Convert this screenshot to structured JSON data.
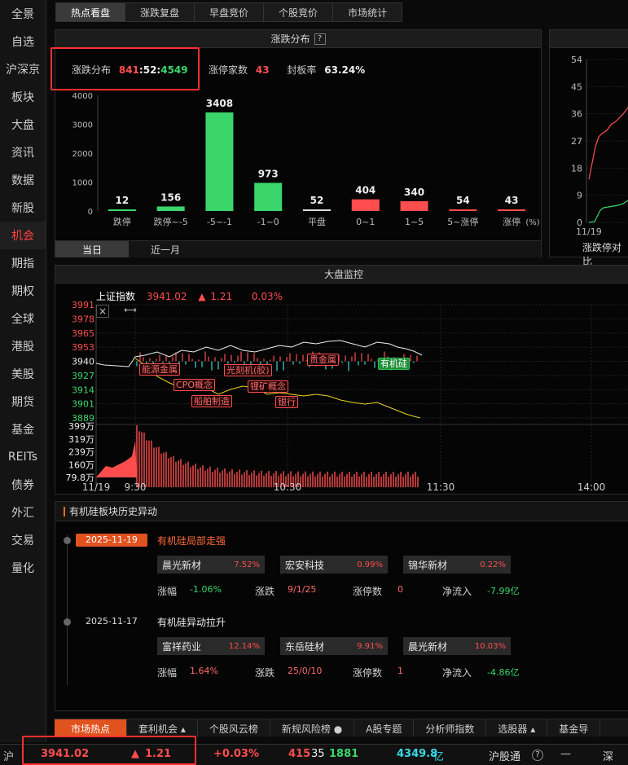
{
  "nav": [
    "全景",
    "自选",
    "沪深京",
    "板块",
    "大盘",
    "资讯",
    "数据",
    "新股",
    "机会",
    "期指",
    "期权",
    "全球",
    "港股",
    "美股",
    "期货",
    "基金",
    "REITs",
    "债券",
    "外汇",
    "交易",
    "量化"
  ],
  "nav_active_index": 8,
  "top_tabs": [
    "热点看盘",
    "涨跌复盘",
    "早盘竞价",
    "个股竞价",
    "市场统计"
  ],
  "dist_panel": {
    "title": "涨跌分布",
    "help": "?",
    "label": "涨跌分布",
    "up": "841",
    "flat": "52",
    "down": "4549",
    "sep": ":",
    "limit_label": "涨停家数",
    "limit_value": "43",
    "seal_label": "封板率",
    "seal_value": "63.24%",
    "unit": "(%)",
    "tabs": [
      "当日",
      "近一月"
    ]
  },
  "chart_data": {
    "type": "bar",
    "categories": [
      "跌停",
      "跌停~-5",
      "-5~-1",
      "-1~0",
      "平盘",
      "0~1",
      "1~5",
      "5~涨停",
      "涨停"
    ],
    "values": [
      12,
      156,
      3408,
      973,
      52,
      404,
      340,
      54,
      43
    ],
    "colors": [
      "#3ad66b",
      "#3ad66b",
      "#3ad66b",
      "#3ad66b",
      "#dddddd",
      "#ff4d4d",
      "#ff4d4d",
      "#ff4d4d",
      "#ff4d4d"
    ],
    "ylim": [
      0,
      4000
    ],
    "yticks": [
      0,
      1000,
      2000,
      3000,
      4000
    ],
    "title": "",
    "xlabel": "",
    "ylabel": ""
  },
  "side_chart": {
    "yticks": [
      "54",
      "45",
      "36",
      "27",
      "18",
      "9",
      "0"
    ],
    "date": "11/19",
    "caption": "涨跌停对比"
  },
  "monitor": {
    "title": "大盘监控",
    "index_name": "上证指数",
    "price": "3941.02",
    "arrow": "▲",
    "change": "1.21",
    "pct": "0.03%",
    "price_ticks_red": [
      "3991",
      "3978",
      "3965",
      "3953"
    ],
    "price_mid": "3940",
    "price_ticks_green": [
      "3927",
      "3914",
      "3901",
      "3889"
    ],
    "vol_ticks": [
      "399万",
      "319万",
      "239万",
      "160万",
      "79.8万"
    ],
    "time_ticks": [
      "11/19",
      "9:30",
      "10:30",
      "11:30",
      "14:00"
    ],
    "tags": [
      "能源金属",
      "CPO概念",
      "船舶制造",
      "光刻机(胶)",
      "锂矿概念",
      "银行",
      "贵金属",
      "有机硅"
    ],
    "close_icon": "×",
    "resize_icon": "⟷"
  },
  "history": {
    "title": "有机硅板块历史异动",
    "events": [
      {
        "date": "2025-11-19",
        "title": "有机硅局部走强",
        "stocks": [
          {
            "name": "晨光新材",
            "pct": "7.52%"
          },
          {
            "name": "宏安科技",
            "pct": "0.99%"
          },
          {
            "name": "锦华新材",
            "pct": "0.22%"
          }
        ],
        "zf_label": "涨幅",
        "zf": "-1.06%",
        "zd_label": "涨跌",
        "zd": "9/1/25",
        "zt_label": "涨停数",
        "zt": "0",
        "jl_label": "净流入",
        "jl": "-7.99亿"
      },
      {
        "date": "2025-11-17",
        "title": "有机硅异动拉升",
        "stocks": [
          {
            "name": "富祥药业",
            "pct": "12.14%"
          },
          {
            "name": "东岳硅材",
            "pct": "9.91%"
          },
          {
            "name": "晨光新材",
            "pct": "10.03%"
          }
        ],
        "zf_label": "涨幅",
        "zf": "1.64%",
        "zd_label": "涨跌",
        "zd": "25/0/10",
        "zt_label": "涨停数",
        "zt": "1",
        "jl_label": "净流入",
        "jl": "-4.86亿"
      }
    ]
  },
  "bottom_tabs": [
    "市场热点",
    "套利机会 ▴",
    "个股风云榜",
    "新规风险榜 ●",
    "A股专题",
    "分析师指数",
    "选股器 ▴",
    "基金导",
    "基金导购"
  ],
  "status": {
    "market": "沪",
    "price": "3941.02",
    "arrow": "▲",
    "change": "1.21",
    "pct": "+0.03%",
    "up": "415",
    "flat": "35",
    "down": "1881",
    "amount": "4349.8",
    "amount_unit": "亿",
    "connect": "沪股通",
    "help": "?",
    "dash": "—",
    "shen": "深"
  }
}
